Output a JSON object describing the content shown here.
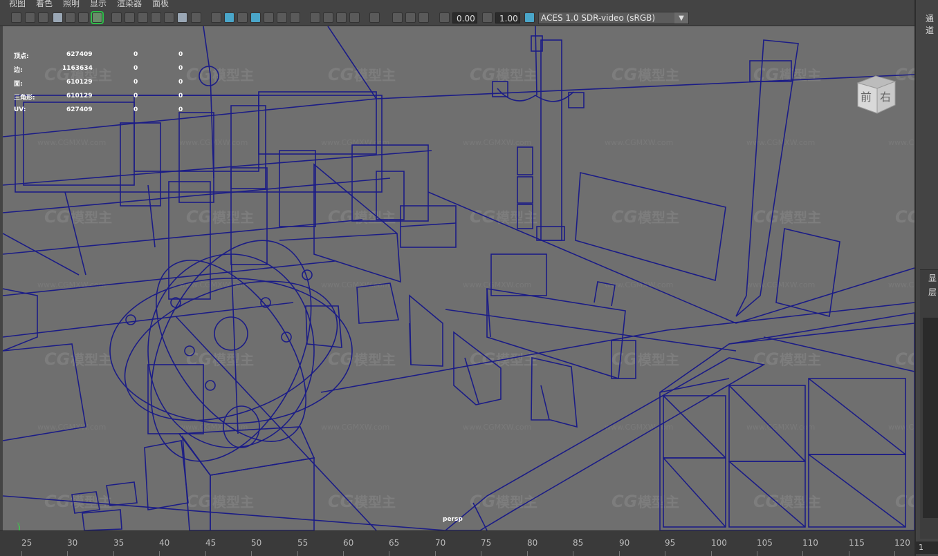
{
  "menu": {
    "items": [
      "视图",
      "着色",
      "照明",
      "显示",
      "渲染器",
      "面板"
    ]
  },
  "toolbar": {
    "exposure": "0.00",
    "gamma": "1.00",
    "colorspace": "ACES 1.0 SDR-video (sRGB)"
  },
  "hud": {
    "rows": [
      {
        "label": "顶点:",
        "v1": "627409",
        "v2": "0",
        "v3": "0"
      },
      {
        "label": "边:",
        "v1": "1163634",
        "v2": "0",
        "v3": "0"
      },
      {
        "label": "面:",
        "v1": "610129",
        "v2": "0",
        "v3": "0"
      },
      {
        "label": "三角形:",
        "v1": "610129",
        "v2": "0",
        "v3": "0"
      },
      {
        "label": "UV:",
        "v1": "627409",
        "v2": "0",
        "v3": "0"
      }
    ]
  },
  "viewport": {
    "camera": "persp",
    "viewcube": {
      "front": "前",
      "right": "右"
    },
    "watermarks": [
      "CG模型主",
      "www.CGMXW.com"
    ]
  },
  "right_panel": {
    "tab": "通道",
    "label_a": "显",
    "label_b": "层"
  },
  "timeline": {
    "ticks": [
      "25",
      "30",
      "35",
      "40",
      "45",
      "50",
      "55",
      "60",
      "65",
      "70",
      "75",
      "80",
      "85",
      "90",
      "95",
      "100",
      "105",
      "110",
      "115",
      "120"
    ],
    "current_frame": "1"
  },
  "colors": {
    "wire": "#1b1c86",
    "viewport_bg": "#6f6f6f"
  }
}
